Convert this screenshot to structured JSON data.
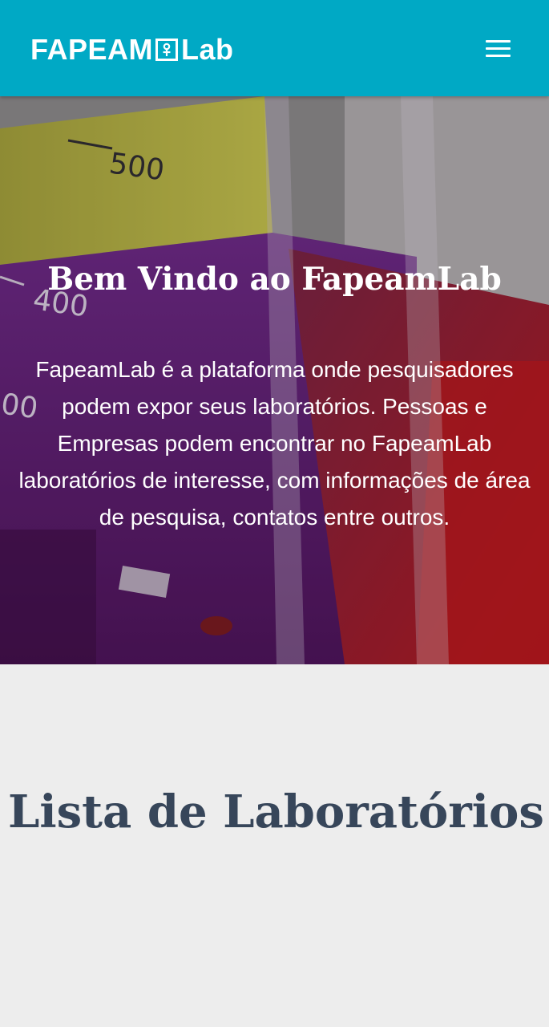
{
  "header": {
    "logo_text_left": "FAPEAM",
    "logo_text_right": "Lab",
    "logo_icon": "flask-box-icon",
    "menu_icon": "hamburger-menu-icon",
    "background_color": "#00a9c5"
  },
  "hero": {
    "title": "Bem Vindo ao FapeamLab",
    "description": "FapeamLab é a plataforma onde pesquisadores podem expor seus laboratórios. Pessoas e Empresas podem encontrar no FapeamLab laboratórios de interesse, com informações de área de pesquisa, contatos entre outros.",
    "background_image": "laboratory-beakers-colored-liquids",
    "beaker_marks": [
      "500",
      "400",
      "00"
    ]
  },
  "main": {
    "section_title": "Lista de Laboratórios",
    "title_color": "#37465a"
  }
}
